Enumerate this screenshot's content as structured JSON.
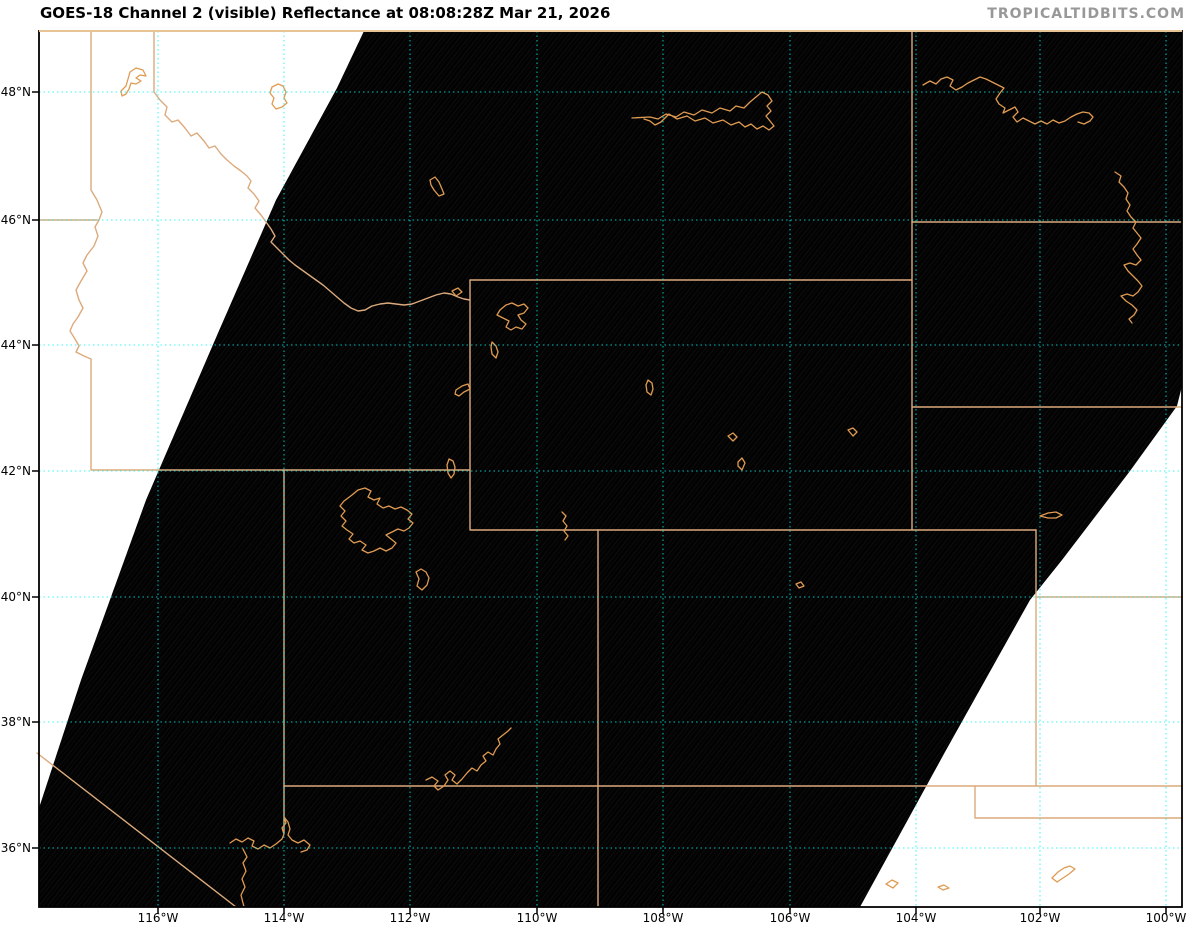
{
  "header": {
    "title": "GOES-18 Channel 2 (visible) Reflectance at 08:08:28Z Mar 21, 2026",
    "watermark": "TROPICALTIDBITS.COM"
  },
  "product": {
    "satellite": "GOES-18",
    "channel": "Channel 2 (visible)",
    "quantity": "Reflectance",
    "time": "08:08:28Z",
    "date": "Mar 21, 2026"
  },
  "axes": {
    "lat": [
      "48°N",
      "46°N",
      "44°N",
      "42°N",
      "40°N",
      "38°N",
      "36°N"
    ],
    "lon": [
      "116°W",
      "114°W",
      "112°W",
      "110°W",
      "108°W",
      "106°W",
      "104°W",
      "102°W",
      "100°W"
    ]
  },
  "colors": {
    "gridline": "#00f5f5",
    "state_border": "#dcaa7c",
    "water_outline": "#e09b52",
    "canada_border_top": "#e6c295",
    "satellite_data_bg": "#020202",
    "no_data_bg": "#ffffff",
    "frame": "#000000",
    "title_text": "#000000",
    "watermark_text": "#989898"
  }
}
